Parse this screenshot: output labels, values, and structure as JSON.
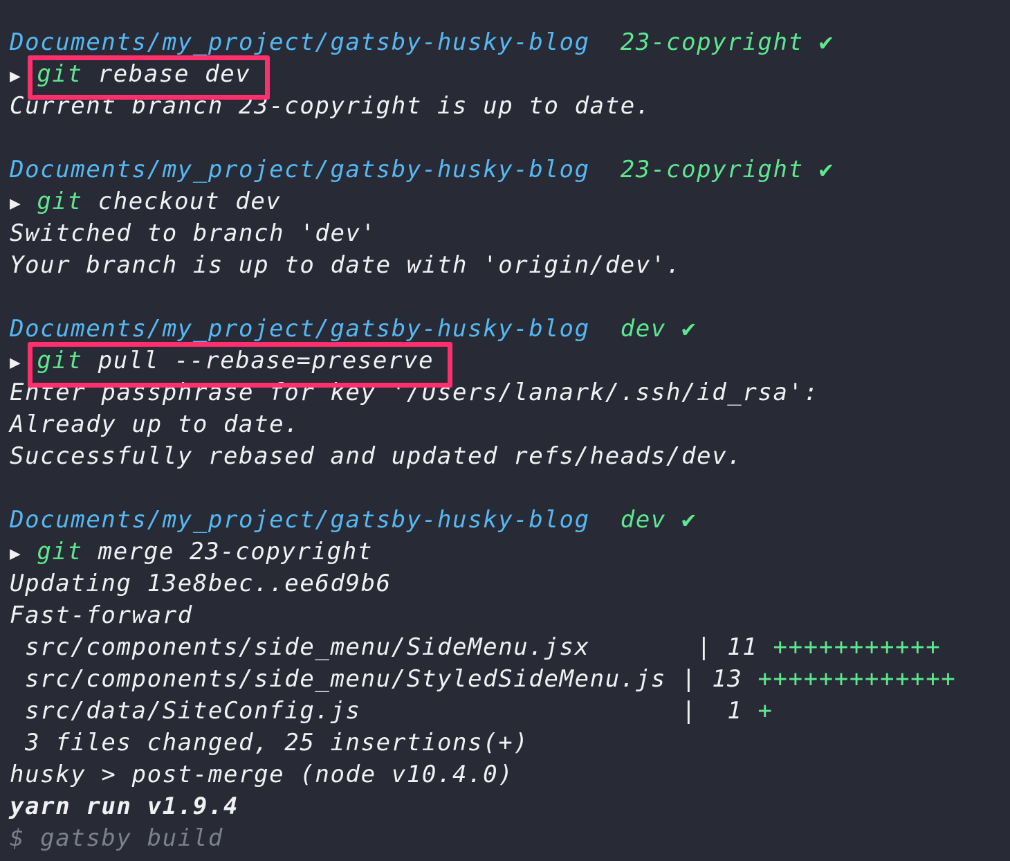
{
  "terminal": {
    "blocks": [
      {
        "prompt": {
          "path": "Documents/my_project/gatsby-husky-blog",
          "branch": "23-copyright",
          "check": "✔"
        },
        "command": {
          "arrow": "▶",
          "git": "git",
          "args": "rebase dev",
          "highlighted": true
        },
        "output": [
          "Current branch 23-copyright is up to date."
        ]
      },
      {
        "prompt": {
          "path": "Documents/my_project/gatsby-husky-blog",
          "branch": "23-copyright",
          "check": "✔"
        },
        "command": {
          "arrow": "▶",
          "git": "git",
          "args": "checkout dev",
          "highlighted": false
        },
        "output": [
          "Switched to branch 'dev'",
          "Your branch is up to date with 'origin/dev'."
        ]
      },
      {
        "prompt": {
          "path": "Documents/my_project/gatsby-husky-blog",
          "branch": "dev",
          "check": "✔"
        },
        "command": {
          "arrow": "▶",
          "git": "git",
          "args": "pull --rebase=preserve",
          "highlighted": true
        },
        "output": [
          "Enter passphrase for key '/Users/lanark/.ssh/id_rsa':",
          "Already up to date.",
          "Successfully rebased and updated refs/heads/dev."
        ]
      },
      {
        "prompt": {
          "path": "Documents/my_project/gatsby-husky-blog",
          "branch": "dev",
          "check": "✔"
        },
        "command": {
          "arrow": "▶",
          "git": "git",
          "args": "merge 23-copyright",
          "highlighted": false
        },
        "output": [
          "Updating 13e8bec..ee6d9b6",
          "Fast-forward"
        ],
        "diffstat": [
          {
            "file": " src/components/side_menu/SideMenu.jsx       ",
            "sep": "|",
            "count": " 11 ",
            "plus": "+++++++++++"
          },
          {
            "file": " src/components/side_menu/StyledSideMenu.js ",
            "sep": "|",
            "count": " 13 ",
            "plus": "+++++++++++++"
          },
          {
            "file": " src/data/SiteConfig.js                     ",
            "sep": "|",
            "count": "  1 ",
            "plus": "+"
          }
        ],
        "summary": " 3 files changed, 25 insertions(+)",
        "hook": "husky > post-merge (node v10.4.0)",
        "yarn": "yarn run v1.9.4",
        "last": "$ gatsby build"
      }
    ]
  },
  "colors": {
    "background": "#282a36",
    "path": "#56b8f2",
    "branch": "#5de88f",
    "text": "#f1f1f3",
    "highlight": "#ff2f6e",
    "dim": "#7c7f8c"
  },
  "icons": {
    "check": "check-icon",
    "arrow": "prompt-arrow-icon"
  }
}
